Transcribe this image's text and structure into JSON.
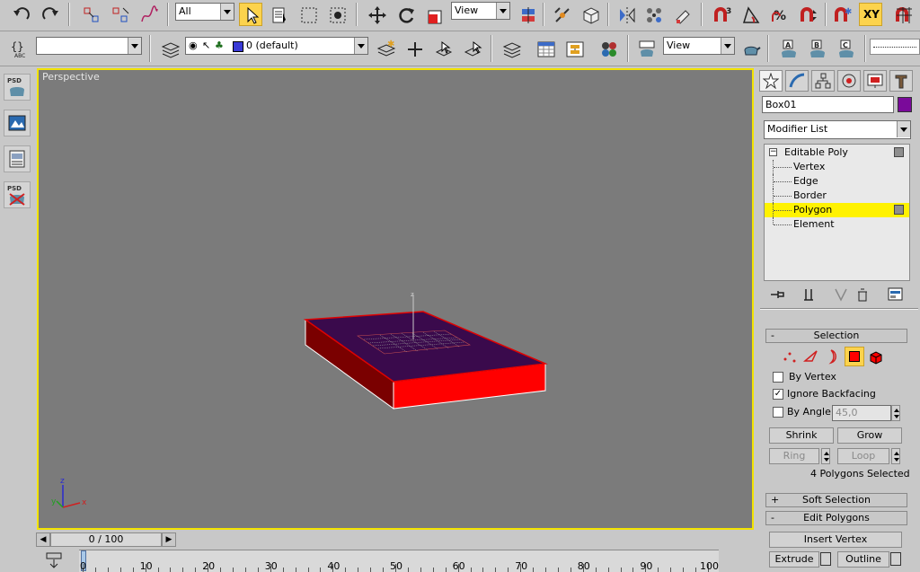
{
  "toolbar": {
    "selection_filter": "All",
    "ref_coord_main": "View",
    "layer_name": "0 (default)",
    "ref_coord_render": "View",
    "snap_axis_label": "XY"
  },
  "viewport": {
    "label": "Perspective",
    "axis_z": "z",
    "axis_x": "x",
    "axis_y": "y"
  },
  "command_panel": {
    "object_name": "Box01",
    "object_color": "#7a0a9a",
    "modifier_list": "Modifier List",
    "stack": {
      "root": "Editable Poly",
      "items": [
        "Vertex",
        "Edge",
        "Border",
        "Polygon",
        "Element"
      ],
      "selected": "Polygon"
    },
    "selection_rollout": {
      "title": "Selection",
      "by_vertex": "By Vertex",
      "by_vertex_checked": false,
      "ignore_backfacing": "Ignore Backfacing",
      "ignore_backfacing_checked": true,
      "by_angle": "By Angle:",
      "by_angle_checked": false,
      "angle_value": "45,0",
      "shrink": "Shrink",
      "grow": "Grow",
      "ring": "Ring",
      "loop": "Loop",
      "status": "4 Polygons Selected"
    },
    "soft_selection": "Soft Selection",
    "edit_polygons": "Edit Polygons",
    "insert_vertex": "Insert Vertex",
    "extrude": "Extrude",
    "outline": "Outline",
    "rollout_collapsed_symbol": "+",
    "rollout_expanded_symbol": "-"
  },
  "timeline": {
    "frame_indicator": "0 / 100",
    "ticks": [
      "0",
      "10",
      "20",
      "30",
      "40",
      "50",
      "60",
      "70",
      "80",
      "90",
      "100"
    ]
  },
  "colors": {
    "viewport_bg": "#7b7b7b",
    "active_border": "#f2e300",
    "box_side": "#ff0000",
    "box_top": "#3a0a4c",
    "highlight": "#fff200"
  }
}
